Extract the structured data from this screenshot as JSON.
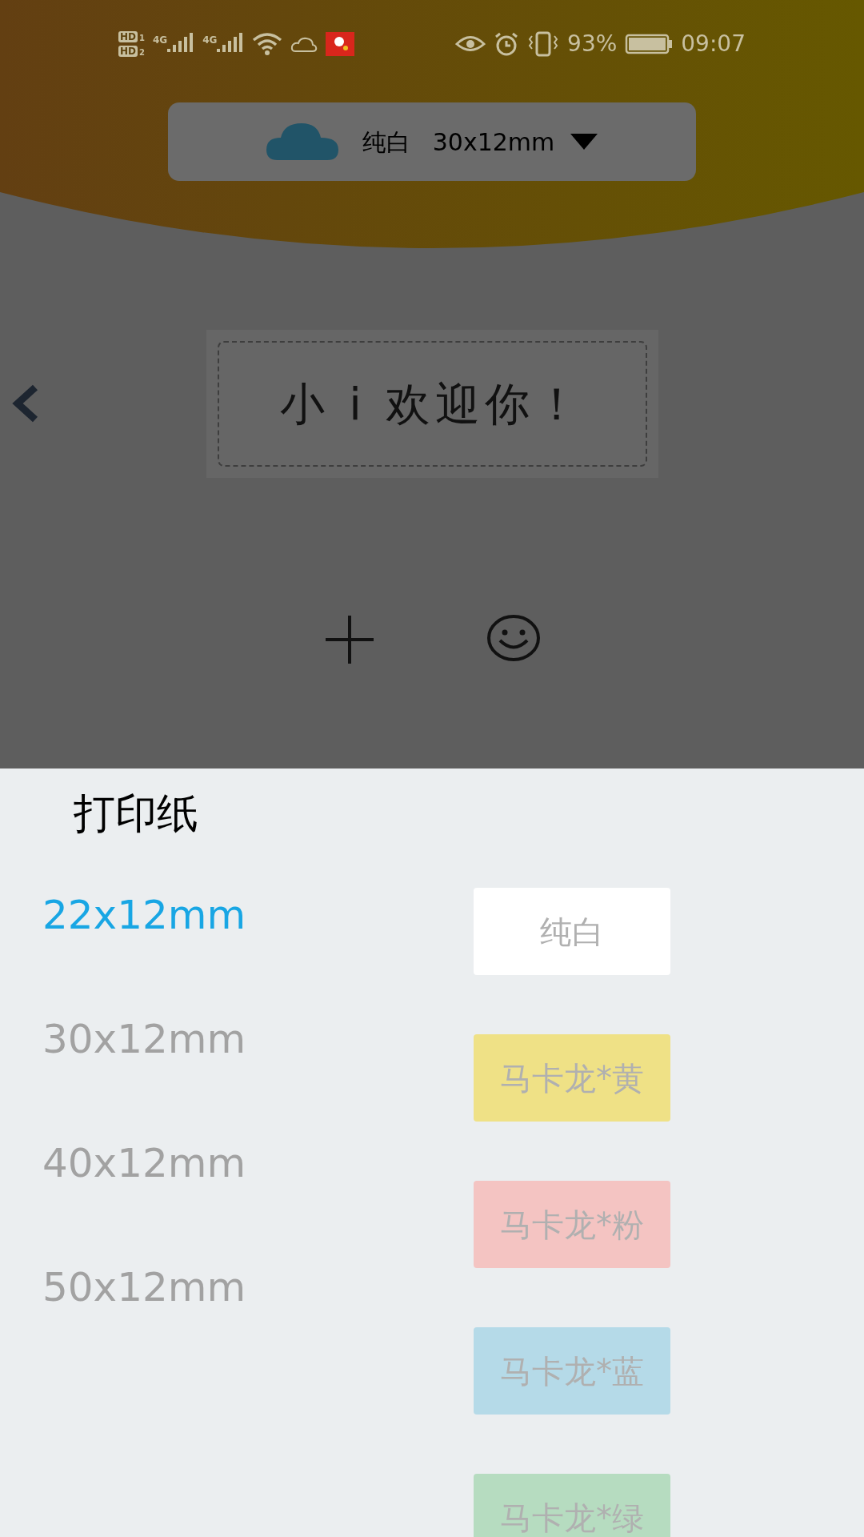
{
  "status_bar": {
    "sim_badges": [
      "HD",
      "HD"
    ],
    "sim_numbers": [
      "1",
      "2"
    ],
    "network": [
      "4G",
      "4G"
    ],
    "battery": "93%",
    "time": "09:07"
  },
  "paper_selector": {
    "color_name": "纯白",
    "size": "30x12mm"
  },
  "label": {
    "text": "小 i 欢迎你！"
  },
  "sheet": {
    "title": "打印纸",
    "sizes": [
      {
        "label": "22x12mm",
        "selected": true
      },
      {
        "label": "30x12mm",
        "selected": false
      },
      {
        "label": "40x12mm",
        "selected": false
      },
      {
        "label": "50x12mm",
        "selected": false
      }
    ],
    "colors": [
      {
        "label": "纯白",
        "color": "#ffffff"
      },
      {
        "label": "马卡龙*黄",
        "color": "#efe186"
      },
      {
        "label": "马卡龙*粉",
        "color": "#f4c4c2"
      },
      {
        "label": "马卡龙*蓝",
        "color": "#b5dae8"
      },
      {
        "label": "马卡龙*绿",
        "color": "#b6dcc0"
      }
    ]
  }
}
